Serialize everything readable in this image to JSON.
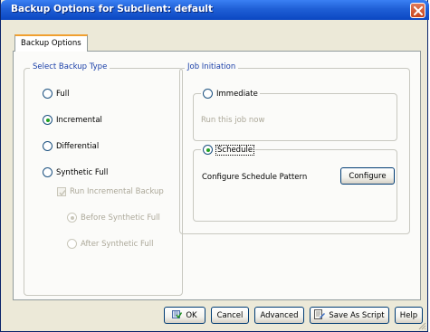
{
  "window": {
    "title": "Backup Options for Subclient: default"
  },
  "tabs": [
    {
      "label": "Backup Options",
      "active": true
    }
  ],
  "backup_type": {
    "group_title": "Select Backup Type",
    "options": [
      {
        "label": "Full",
        "selected": false,
        "enabled": true
      },
      {
        "label": "Incremental",
        "selected": true,
        "enabled": true
      },
      {
        "label": "Differential",
        "selected": false,
        "enabled": true
      },
      {
        "label": "Synthetic Full",
        "selected": false,
        "enabled": true
      }
    ],
    "run_incremental": {
      "label": "Run Incremental Backup",
      "checked": true,
      "enabled": false
    },
    "sub_options": [
      {
        "label": "Before Synthetic Full",
        "selected": true,
        "enabled": false
      },
      {
        "label": "After Synthetic Full",
        "selected": false,
        "enabled": false
      }
    ]
  },
  "job_initiation": {
    "group_title": "Job Initiation",
    "immediate": {
      "label": "Immediate",
      "selected": false,
      "description": "Run this job now"
    },
    "schedule": {
      "label": "Schedule",
      "selected": true,
      "description": "Configure Schedule Pattern"
    },
    "configure_label": "Configure"
  },
  "footer": {
    "ok_label": "OK",
    "cancel_label": "Cancel",
    "advanced_label": "Advanced",
    "save_script_label": "Save As Script",
    "help_label": "Help"
  },
  "colors": {
    "titlebar": "#0b47c2",
    "group_title": "#1a3fa8",
    "radio_selected": "#21a121",
    "disabled_text": "#aca899"
  },
  "icons": {
    "close": "close-icon",
    "ok": "ok-icon",
    "save_script": "script-icon"
  }
}
